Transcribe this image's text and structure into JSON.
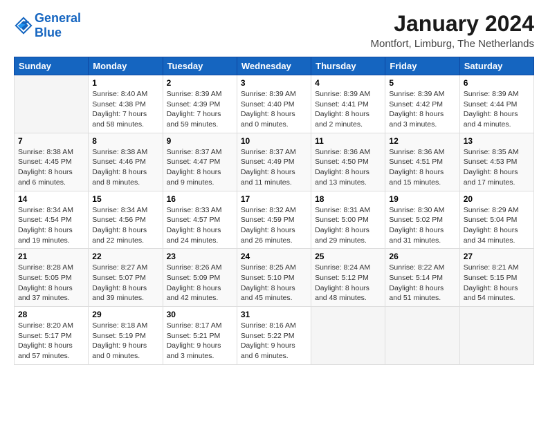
{
  "header": {
    "logo_line1": "General",
    "logo_line2": "Blue",
    "month_title": "January 2024",
    "location": "Montfort, Limburg, The Netherlands"
  },
  "days_of_week": [
    "Sunday",
    "Monday",
    "Tuesday",
    "Wednesday",
    "Thursday",
    "Friday",
    "Saturday"
  ],
  "weeks": [
    [
      {
        "day": "",
        "info": ""
      },
      {
        "day": "1",
        "info": "Sunrise: 8:40 AM\nSunset: 4:38 PM\nDaylight: 7 hours\nand 58 minutes."
      },
      {
        "day": "2",
        "info": "Sunrise: 8:39 AM\nSunset: 4:39 PM\nDaylight: 7 hours\nand 59 minutes."
      },
      {
        "day": "3",
        "info": "Sunrise: 8:39 AM\nSunset: 4:40 PM\nDaylight: 8 hours\nand 0 minutes."
      },
      {
        "day": "4",
        "info": "Sunrise: 8:39 AM\nSunset: 4:41 PM\nDaylight: 8 hours\nand 2 minutes."
      },
      {
        "day": "5",
        "info": "Sunrise: 8:39 AM\nSunset: 4:42 PM\nDaylight: 8 hours\nand 3 minutes."
      },
      {
        "day": "6",
        "info": "Sunrise: 8:39 AM\nSunset: 4:44 PM\nDaylight: 8 hours\nand 4 minutes."
      }
    ],
    [
      {
        "day": "7",
        "info": "Sunrise: 8:38 AM\nSunset: 4:45 PM\nDaylight: 8 hours\nand 6 minutes."
      },
      {
        "day": "8",
        "info": "Sunrise: 8:38 AM\nSunset: 4:46 PM\nDaylight: 8 hours\nand 8 minutes."
      },
      {
        "day": "9",
        "info": "Sunrise: 8:37 AM\nSunset: 4:47 PM\nDaylight: 8 hours\nand 9 minutes."
      },
      {
        "day": "10",
        "info": "Sunrise: 8:37 AM\nSunset: 4:49 PM\nDaylight: 8 hours\nand 11 minutes."
      },
      {
        "day": "11",
        "info": "Sunrise: 8:36 AM\nSunset: 4:50 PM\nDaylight: 8 hours\nand 13 minutes."
      },
      {
        "day": "12",
        "info": "Sunrise: 8:36 AM\nSunset: 4:51 PM\nDaylight: 8 hours\nand 15 minutes."
      },
      {
        "day": "13",
        "info": "Sunrise: 8:35 AM\nSunset: 4:53 PM\nDaylight: 8 hours\nand 17 minutes."
      }
    ],
    [
      {
        "day": "14",
        "info": "Sunrise: 8:34 AM\nSunset: 4:54 PM\nDaylight: 8 hours\nand 19 minutes."
      },
      {
        "day": "15",
        "info": "Sunrise: 8:34 AM\nSunset: 4:56 PM\nDaylight: 8 hours\nand 22 minutes."
      },
      {
        "day": "16",
        "info": "Sunrise: 8:33 AM\nSunset: 4:57 PM\nDaylight: 8 hours\nand 24 minutes."
      },
      {
        "day": "17",
        "info": "Sunrise: 8:32 AM\nSunset: 4:59 PM\nDaylight: 8 hours\nand 26 minutes."
      },
      {
        "day": "18",
        "info": "Sunrise: 8:31 AM\nSunset: 5:00 PM\nDaylight: 8 hours\nand 29 minutes."
      },
      {
        "day": "19",
        "info": "Sunrise: 8:30 AM\nSunset: 5:02 PM\nDaylight: 8 hours\nand 31 minutes."
      },
      {
        "day": "20",
        "info": "Sunrise: 8:29 AM\nSunset: 5:04 PM\nDaylight: 8 hours\nand 34 minutes."
      }
    ],
    [
      {
        "day": "21",
        "info": "Sunrise: 8:28 AM\nSunset: 5:05 PM\nDaylight: 8 hours\nand 37 minutes."
      },
      {
        "day": "22",
        "info": "Sunrise: 8:27 AM\nSunset: 5:07 PM\nDaylight: 8 hours\nand 39 minutes."
      },
      {
        "day": "23",
        "info": "Sunrise: 8:26 AM\nSunset: 5:09 PM\nDaylight: 8 hours\nand 42 minutes."
      },
      {
        "day": "24",
        "info": "Sunrise: 8:25 AM\nSunset: 5:10 PM\nDaylight: 8 hours\nand 45 minutes."
      },
      {
        "day": "25",
        "info": "Sunrise: 8:24 AM\nSunset: 5:12 PM\nDaylight: 8 hours\nand 48 minutes."
      },
      {
        "day": "26",
        "info": "Sunrise: 8:22 AM\nSunset: 5:14 PM\nDaylight: 8 hours\nand 51 minutes."
      },
      {
        "day": "27",
        "info": "Sunrise: 8:21 AM\nSunset: 5:15 PM\nDaylight: 8 hours\nand 54 minutes."
      }
    ],
    [
      {
        "day": "28",
        "info": "Sunrise: 8:20 AM\nSunset: 5:17 PM\nDaylight: 8 hours\nand 57 minutes."
      },
      {
        "day": "29",
        "info": "Sunrise: 8:18 AM\nSunset: 5:19 PM\nDaylight: 9 hours\nand 0 minutes."
      },
      {
        "day": "30",
        "info": "Sunrise: 8:17 AM\nSunset: 5:21 PM\nDaylight: 9 hours\nand 3 minutes."
      },
      {
        "day": "31",
        "info": "Sunrise: 8:16 AM\nSunset: 5:22 PM\nDaylight: 9 hours\nand 6 minutes."
      },
      {
        "day": "",
        "info": ""
      },
      {
        "day": "",
        "info": ""
      },
      {
        "day": "",
        "info": ""
      }
    ]
  ]
}
